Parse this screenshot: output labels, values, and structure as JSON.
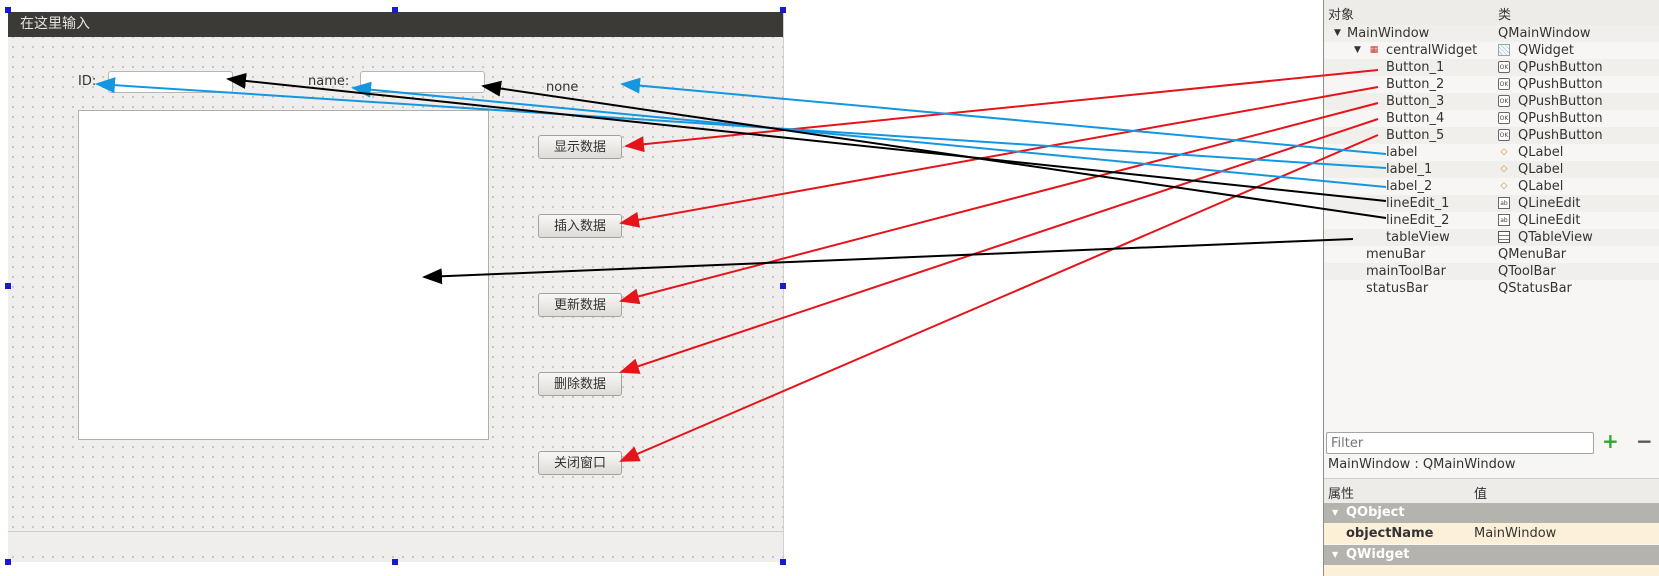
{
  "window": {
    "title_placeholder": "在这里输入"
  },
  "form": {
    "id_label": "ID:",
    "name_label": "name:",
    "none_label": "none",
    "buttons": [
      "显示数据",
      "插入数据",
      "更新数据",
      "删除数据",
      "关闭窗口"
    ]
  },
  "object_inspector": {
    "headers": {
      "object": "对象",
      "class": "类"
    },
    "tree": [
      {
        "name": "MainWindow",
        "class": "QMainWindow",
        "icon": "",
        "expander": "▼"
      },
      {
        "name": "centralWidget",
        "class": "QWidget",
        "icon": "widget-icon",
        "expander": "▼"
      },
      {
        "name": "Button_1",
        "class": "QPushButton",
        "icon": "push-button-icon"
      },
      {
        "name": "Button_2",
        "class": "QPushButton",
        "icon": "push-button-icon"
      },
      {
        "name": "Button_3",
        "class": "QPushButton",
        "icon": "push-button-icon"
      },
      {
        "name": "Button_4",
        "class": "QPushButton",
        "icon": "push-button-icon"
      },
      {
        "name": "Button_5",
        "class": "QPushButton",
        "icon": "push-button-icon"
      },
      {
        "name": "label",
        "class": "QLabel",
        "icon": "label-tag-icon"
      },
      {
        "name": "label_1",
        "class": "QLabel",
        "icon": "label-tag-icon"
      },
      {
        "name": "label_2",
        "class": "QLabel",
        "icon": "label-tag-icon"
      },
      {
        "name": "lineEdit_1",
        "class": "QLineEdit",
        "icon": "line-edit-icon"
      },
      {
        "name": "lineEdit_2",
        "class": "QLineEdit",
        "icon": "line-edit-icon"
      },
      {
        "name": "tableView",
        "class": "QTableView",
        "icon": "table-view-icon"
      },
      {
        "name": "menuBar",
        "class": "QMenuBar",
        "icon": ""
      },
      {
        "name": "mainToolBar",
        "class": "QToolBar",
        "icon": ""
      },
      {
        "name": "statusBar",
        "class": "QStatusBar",
        "icon": ""
      }
    ]
  },
  "property_editor": {
    "filter_placeholder": "Filter",
    "add_label": "+",
    "remove_label": "−",
    "object_line": "MainWindow : QMainWindow",
    "headers": {
      "property": "属性",
      "value": "值"
    },
    "groups": [
      "QObject",
      "QWidget"
    ],
    "rows": [
      {
        "name": "objectName",
        "value": "MainWindow"
      }
    ]
  },
  "colors": {
    "arrow_red": "#e5141a",
    "arrow_blue": "#1497e0",
    "arrow_black": "#000000",
    "selection_handle": "#1a1acb"
  }
}
